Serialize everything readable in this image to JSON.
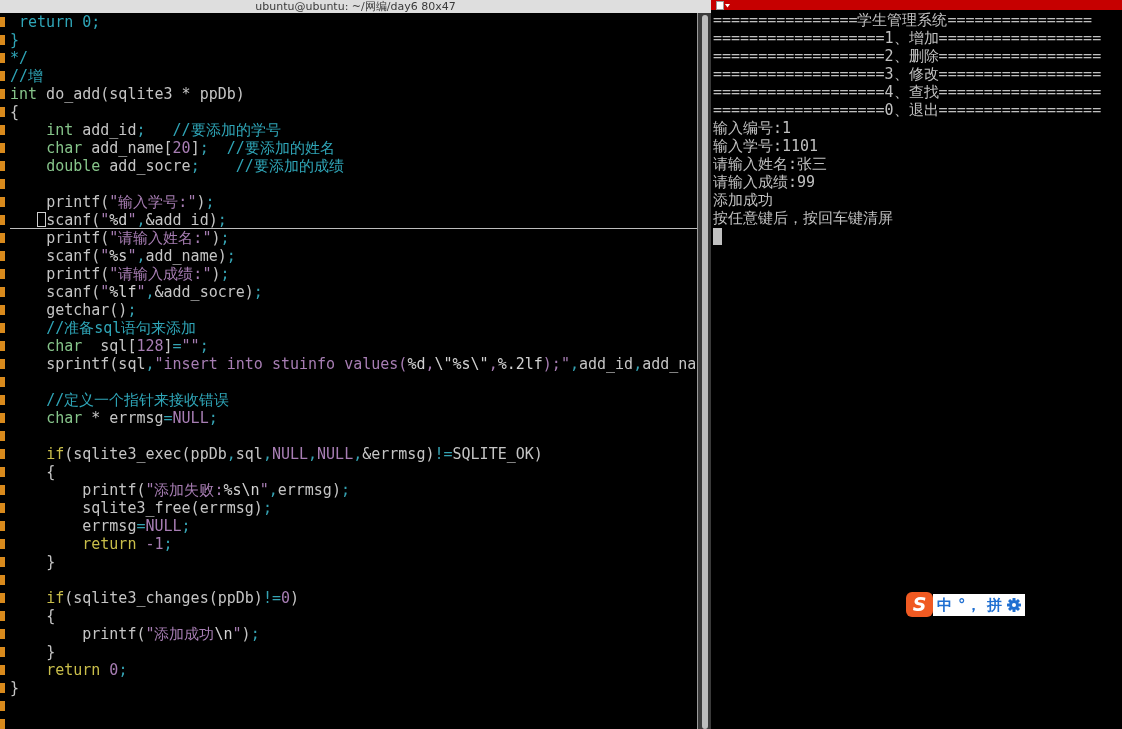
{
  "window": {
    "title": "ubuntu@ubuntu: ~/网编/day6 80x47"
  },
  "editor": {
    "lines": [
      {
        "current": false,
        "tokens": [
          {
            "kind": "comment",
            "text": " return 0;"
          }
        ]
      },
      {
        "current": false,
        "tokens": [
          {
            "kind": "comment",
            "text": "}"
          }
        ]
      },
      {
        "current": false,
        "tokens": [
          {
            "kind": "comment",
            "text": "*/"
          }
        ]
      },
      {
        "current": false,
        "tokens": [
          {
            "kind": "comment",
            "text": "//增"
          }
        ]
      },
      {
        "current": false,
        "tokens": [
          {
            "kind": "type",
            "text": "int"
          },
          {
            "kind": "plain",
            "text": " do_add(sqlite3 * ppDb)"
          }
        ]
      },
      {
        "current": false,
        "tokens": [
          {
            "kind": "plain",
            "text": "{"
          }
        ]
      },
      {
        "current": false,
        "tokens": [
          {
            "kind": "type",
            "text": "    int"
          },
          {
            "kind": "plain",
            "text": " add_id"
          },
          {
            "kind": "operator",
            "text": ";   "
          },
          {
            "kind": "comment",
            "text": "//要添加的学号"
          }
        ]
      },
      {
        "current": false,
        "tokens": [
          {
            "kind": "type",
            "text": "    char"
          },
          {
            "kind": "plain",
            "text": " add_name["
          },
          {
            "kind": "number",
            "text": "20"
          },
          {
            "kind": "plain",
            "text": "]"
          },
          {
            "kind": "operator",
            "text": ";  "
          },
          {
            "kind": "comment",
            "text": "//要添加的姓名"
          }
        ]
      },
      {
        "current": false,
        "tokens": [
          {
            "kind": "type",
            "text": "    double"
          },
          {
            "kind": "plain",
            "text": " add_socre"
          },
          {
            "kind": "operator",
            "text": ";    "
          },
          {
            "kind": "comment",
            "text": "//要添加的成绩"
          }
        ]
      },
      {
        "current": false
      },
      {
        "current": false,
        "tokens": [
          {
            "kind": "plain",
            "text": "    printf("
          },
          {
            "kind": "string",
            "text": "\"输入学号:\""
          },
          {
            "kind": "plain",
            "text": ")"
          },
          {
            "kind": "operator",
            "text": ";"
          }
        ]
      },
      {
        "current": true,
        "tokens": [
          {
            "kind": "plain",
            "text": "    scanf("
          },
          {
            "kind": "string",
            "text": "\""
          },
          {
            "kind": "special",
            "text": "%d"
          },
          {
            "kind": "string",
            "text": "\""
          },
          {
            "kind": "operator",
            "text": ","
          },
          {
            "kind": "plain",
            "text": "&add_id)"
          },
          {
            "kind": "operator",
            "text": ";"
          }
        ]
      },
      {
        "current": false,
        "tokens": [
          {
            "kind": "plain",
            "text": "    printf("
          },
          {
            "kind": "string",
            "text": "\"请输入姓名:\""
          },
          {
            "kind": "plain",
            "text": ")"
          },
          {
            "kind": "operator",
            "text": ";"
          }
        ]
      },
      {
        "current": false,
        "tokens": [
          {
            "kind": "plain",
            "text": "    scanf("
          },
          {
            "kind": "string",
            "text": "\""
          },
          {
            "kind": "special",
            "text": "%s"
          },
          {
            "kind": "string",
            "text": "\""
          },
          {
            "kind": "operator",
            "text": ","
          },
          {
            "kind": "plain",
            "text": "add_name)"
          },
          {
            "kind": "operator",
            "text": ";"
          }
        ]
      },
      {
        "current": false,
        "tokens": [
          {
            "kind": "plain",
            "text": "    printf("
          },
          {
            "kind": "string",
            "text": "\"请输入成绩:\""
          },
          {
            "kind": "plain",
            "text": ")"
          },
          {
            "kind": "operator",
            "text": ";"
          }
        ]
      },
      {
        "current": false,
        "tokens": [
          {
            "kind": "plain",
            "text": "    scanf("
          },
          {
            "kind": "string",
            "text": "\""
          },
          {
            "kind": "special",
            "text": "%lf"
          },
          {
            "kind": "string",
            "text": "\""
          },
          {
            "kind": "operator",
            "text": ","
          },
          {
            "kind": "plain",
            "text": "&add_socre)"
          },
          {
            "kind": "operator",
            "text": ";"
          }
        ]
      },
      {
        "current": false,
        "tokens": [
          {
            "kind": "plain",
            "text": "    getchar()"
          },
          {
            "kind": "operator",
            "text": ";"
          }
        ]
      },
      {
        "current": false,
        "tokens": [
          {
            "kind": "comment",
            "text": "    //准备sql语句来添加"
          }
        ]
      },
      {
        "current": false,
        "tokens": [
          {
            "kind": "type",
            "text": "    char"
          },
          {
            "kind": "plain",
            "text": "  sql["
          },
          {
            "kind": "number",
            "text": "128"
          },
          {
            "kind": "plain",
            "text": "]"
          },
          {
            "kind": "operator",
            "text": "="
          },
          {
            "kind": "string",
            "text": "\"\""
          },
          {
            "kind": "operator",
            "text": ";"
          }
        ]
      },
      {
        "current": false,
        "tokens": [
          {
            "kind": "plain",
            "text": "    sprintf(sql"
          },
          {
            "kind": "operator",
            "text": ","
          },
          {
            "kind": "string",
            "text": "\"insert into stuinfo values("
          },
          {
            "kind": "special",
            "text": "%d"
          },
          {
            "kind": "string",
            "text": ","
          },
          {
            "kind": "special",
            "text": "\\\"%s\\\""
          },
          {
            "kind": "string",
            "text": ","
          },
          {
            "kind": "special",
            "text": "%.2lf"
          },
          {
            "kind": "string",
            "text": ");\""
          },
          {
            "kind": "operator",
            "text": ","
          },
          {
            "kind": "plain",
            "text": "add_id"
          },
          {
            "kind": "operator",
            "text": ","
          },
          {
            "kind": "plain",
            "text": "add_na"
          }
        ]
      },
      {
        "current": false
      },
      {
        "current": false,
        "tokens": [
          {
            "kind": "comment",
            "text": "    //定义一个指针来接收错误"
          }
        ]
      },
      {
        "current": false,
        "tokens": [
          {
            "kind": "type",
            "text": "    char"
          },
          {
            "kind": "plain",
            "text": " * errmsg"
          },
          {
            "kind": "operator",
            "text": "="
          },
          {
            "kind": "constant",
            "text": "NULL"
          },
          {
            "kind": "operator",
            "text": ";"
          }
        ]
      },
      {
        "current": false
      },
      {
        "current": false,
        "tokens": [
          {
            "kind": "statement",
            "text": "    if"
          },
          {
            "kind": "plain",
            "text": "(sqlite3_exec(ppDb"
          },
          {
            "kind": "operator",
            "text": ","
          },
          {
            "kind": "plain",
            "text": "sql"
          },
          {
            "kind": "operator",
            "text": ","
          },
          {
            "kind": "constant",
            "text": "NULL"
          },
          {
            "kind": "operator",
            "text": ","
          },
          {
            "kind": "constant",
            "text": "NULL"
          },
          {
            "kind": "operator",
            "text": ","
          },
          {
            "kind": "plain",
            "text": "&errmsg)"
          },
          {
            "kind": "operator",
            "text": "!="
          },
          {
            "kind": "plain",
            "text": "SQLITE_OK)"
          }
        ]
      },
      {
        "current": false,
        "tokens": [
          {
            "kind": "plain",
            "text": "    {"
          }
        ]
      },
      {
        "current": false,
        "tokens": [
          {
            "kind": "plain",
            "text": "        printf("
          },
          {
            "kind": "string",
            "text": "\"添加失败:"
          },
          {
            "kind": "special",
            "text": "%s\\n"
          },
          {
            "kind": "string",
            "text": "\""
          },
          {
            "kind": "operator",
            "text": ","
          },
          {
            "kind": "plain",
            "text": "errmsg)"
          },
          {
            "kind": "operator",
            "text": ";"
          }
        ]
      },
      {
        "current": false,
        "tokens": [
          {
            "kind": "plain",
            "text": "        sqlite3_free(errmsg)"
          },
          {
            "kind": "operator",
            "text": ";"
          }
        ]
      },
      {
        "current": false,
        "tokens": [
          {
            "kind": "plain",
            "text": "        errmsg"
          },
          {
            "kind": "operator",
            "text": "="
          },
          {
            "kind": "constant",
            "text": "NULL"
          },
          {
            "kind": "operator",
            "text": ";"
          }
        ]
      },
      {
        "current": false,
        "tokens": [
          {
            "kind": "statement",
            "text": "        return "
          },
          {
            "kind": "number",
            "text": "-1"
          },
          {
            "kind": "operator",
            "text": ";"
          }
        ]
      },
      {
        "current": false,
        "tokens": [
          {
            "kind": "plain",
            "text": "    }"
          }
        ]
      },
      {
        "current": false
      },
      {
        "current": false,
        "tokens": [
          {
            "kind": "statement",
            "text": "    if"
          },
          {
            "kind": "plain",
            "text": "(sqlite3_changes(ppDb)"
          },
          {
            "kind": "operator",
            "text": "!="
          },
          {
            "kind": "number",
            "text": "0"
          },
          {
            "kind": "plain",
            "text": ")"
          }
        ]
      },
      {
        "current": false,
        "tokens": [
          {
            "kind": "plain",
            "text": "    {"
          }
        ]
      },
      {
        "current": false,
        "tokens": [
          {
            "kind": "plain",
            "text": "        printf("
          },
          {
            "kind": "string",
            "text": "\"添加成功"
          },
          {
            "kind": "special",
            "text": "\\n"
          },
          {
            "kind": "string",
            "text": "\""
          },
          {
            "kind": "plain",
            "text": ")"
          },
          {
            "kind": "operator",
            "text": ";"
          }
        ]
      },
      {
        "current": false,
        "tokens": [
          {
            "kind": "plain",
            "text": "    }"
          }
        ]
      },
      {
        "current": false,
        "tokens": [
          {
            "kind": "statement",
            "text": "    return "
          },
          {
            "kind": "number",
            "text": "0"
          },
          {
            "kind": "operator",
            "text": ";"
          }
        ]
      },
      {
        "current": false,
        "tokens": [
          {
            "kind": "plain",
            "text": "}"
          }
        ]
      }
    ]
  },
  "console": {
    "lines": [
      "================学生管理系统================",
      "===================1、增加==================",
      "===================2、删除==================",
      "===================3、修改==================",
      "===================4、查找==================",
      "===================0、退出==================",
      "输入编号:1",
      "输入学号:1101",
      "请输入姓名:张三",
      "请输入成绩:99",
      "添加成功",
      "按任意键后，按回车键清屏"
    ],
    "cursor_shown": true
  },
  "ime_toolbar": {
    "logo": "S",
    "mode": "中",
    "punctuation": "°，",
    "input_method": "拼"
  }
}
